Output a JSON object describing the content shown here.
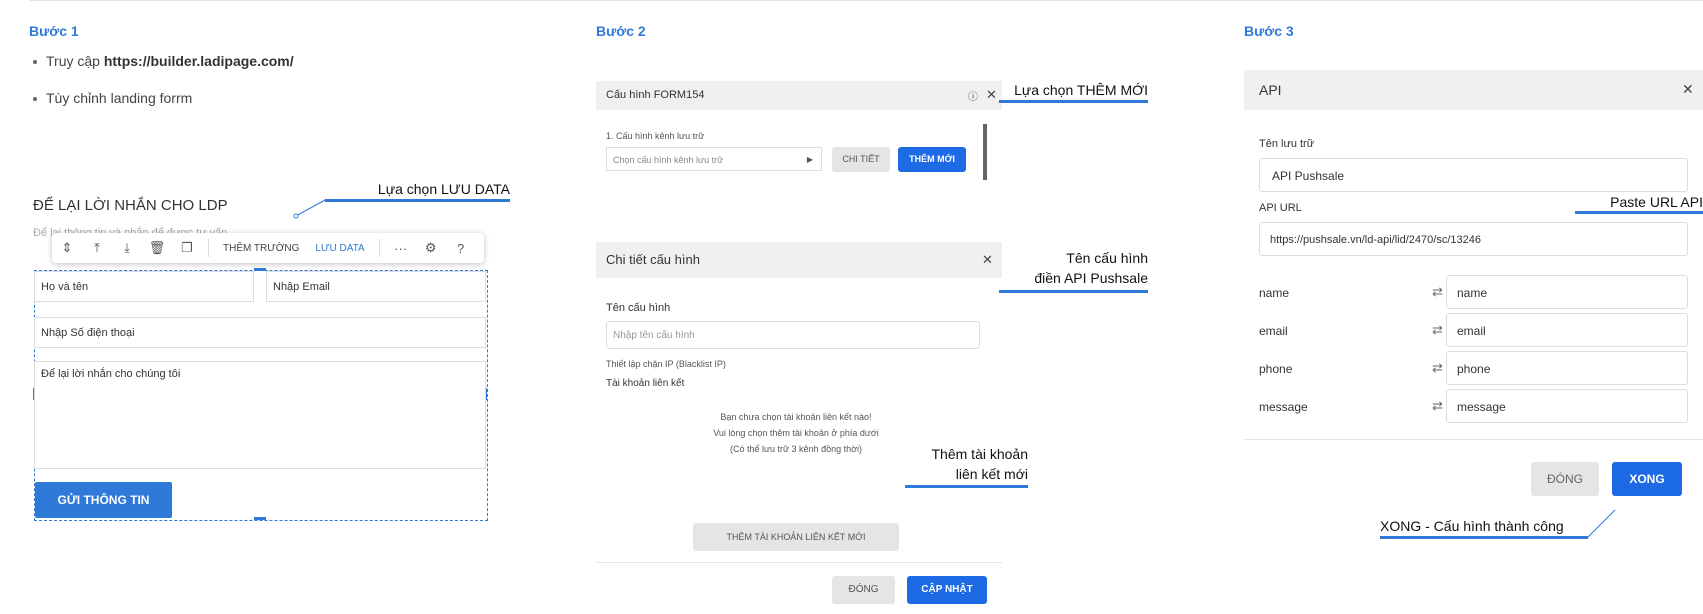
{
  "steps": {
    "step1": "Bước 1",
    "step2": "Bước 2",
    "step3": "Bước 3"
  },
  "step1": {
    "bullet1_prefix": "Truy cập ",
    "bullet1_url": "https://builder.ladipage.com/",
    "bullet2": "Tùy chỉnh landing forrm",
    "form_title": "ĐỂ LẠI LỜI NHẮN CHO LDP",
    "form_subtitle": "Để lại thông tin và nhắn để được tư vấn",
    "toolbar": {
      "them_truong": "THÊM TRƯỜNG",
      "luu_data": "LƯU DATA",
      "more": "···"
    },
    "fields": {
      "name": "Họ và tên",
      "email": "Nhập Email",
      "phone": "Nhập Số điện thoại",
      "message": "Để lại lời nhắn cho chúng tôi"
    },
    "submit": "GỬI THÔNG TIN",
    "annotation": "Lựa chọn LƯU DATA"
  },
  "step2": {
    "form_config": {
      "title": "Cấu hình FORM154",
      "section": "1. Cấu hình kênh lưu trữ",
      "select_placeholder": "Chọn cấu hình kênh lưu trữ",
      "chi_tiet": "CHI TIẾT",
      "them_moi": "THÊM MỚI"
    },
    "annotation_them_moi": "Lựa chọn THÊM MỚI",
    "detail": {
      "title": "Chi tiết cấu hình",
      "ten_cau_hinh_label": "Tên cấu hình",
      "ten_cau_hinh_placeholder": "Nhập tên cấu hình",
      "blacklist": "Thiết lập chặn IP (Blacklist IP)",
      "tai_khoan_label": "Tài khoản liên kết",
      "empty_line1": "Bạn chưa chọn tài khoản liên kết nào!",
      "empty_line2": "Vui lòng chọn thêm tài khoản ở phía dưới",
      "empty_line3": "(Có thể lưu trữ 3 kênh đồng thời)",
      "add_account": "THÊM TÀI KHOẢN LIÊN KẾT MỚI",
      "dong": "ĐÓNG",
      "cap_nhat": "CẬP NHẬT"
    },
    "annotation_ten_line1": "Tên cấu hình",
    "annotation_ten_line2": "điền API Pushsale",
    "annotation_tk_line1": "Thêm tài khoản",
    "annotation_tk_line2": "liên kết mới"
  },
  "step3": {
    "title": "API",
    "ten_luu_tru_label": "Tên lưu trữ",
    "ten_luu_tru_value": "API Pushsale",
    "api_url_label": "API URL",
    "api_url_value": "https://pushsale.vn/ld-api/lid/2470/sc/13246",
    "annotation_url": "Paste URL API",
    "mappings": [
      {
        "key": "name",
        "value": "name"
      },
      {
        "key": "email",
        "value": "email"
      },
      {
        "key": "phone",
        "value": "phone"
      },
      {
        "key": "message",
        "value": "message"
      }
    ],
    "dong": "ĐÓNG",
    "xong": "XONG",
    "annotation_xong": "XONG - Cấu hình thành công"
  },
  "colors": {
    "accent": "#2f7ad8",
    "button_primary": "#1d6ae5"
  }
}
